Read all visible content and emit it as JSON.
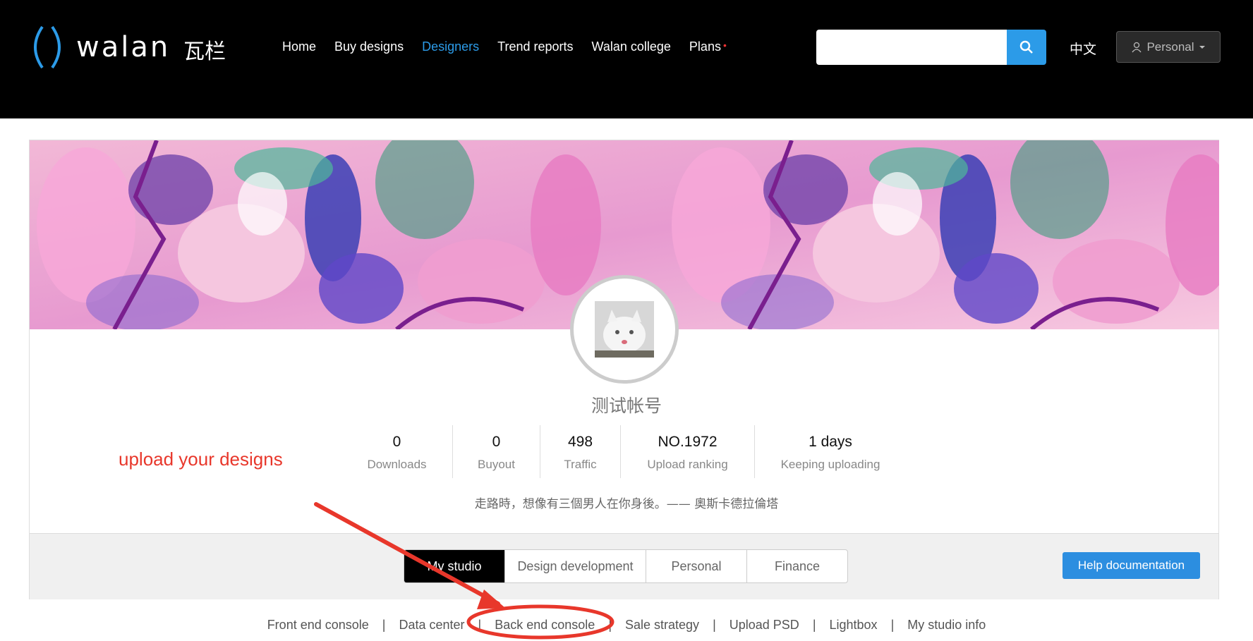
{
  "header": {
    "logo_word": "walan",
    "logo_cn": "瓦栏",
    "nav": [
      {
        "label": "Home",
        "active": false
      },
      {
        "label": "Buy designs",
        "active": false
      },
      {
        "label": "Designers",
        "active": true
      },
      {
        "label": "Trend reports",
        "active": false
      },
      {
        "label": "Walan college",
        "active": false
      },
      {
        "label": "Plans",
        "active": false,
        "badge": "•"
      }
    ],
    "search": {
      "placeholder": "",
      "value": ""
    },
    "language": "中文",
    "account_label": "Personal"
  },
  "profile": {
    "username": "测试帐号",
    "stats": [
      {
        "value": "0",
        "label": "Downloads"
      },
      {
        "value": "0",
        "label": "Buyout"
      },
      {
        "value": "498",
        "label": "Traffic"
      },
      {
        "value": "NO.1972",
        "label": "Upload ranking"
      },
      {
        "value": "1 days",
        "label": "Keeping uploading"
      }
    ],
    "motto": "走路時，想像有三個男人在你身後。—— 奧斯卡德拉倫塔"
  },
  "annotation": {
    "text": "upload your designs",
    "color": "#e8372b"
  },
  "tabs": [
    {
      "label": "My studio",
      "active": true
    },
    {
      "label": "Design development",
      "active": false
    },
    {
      "label": "Personal",
      "active": false
    },
    {
      "label": "Finance",
      "active": false
    }
  ],
  "help_label": "Help documentation",
  "subnav": [
    "Front end console",
    "Data center",
    "Back end console",
    "Sale strategy",
    "Upload PSD",
    "Lightbox",
    "My studio info"
  ],
  "colors": {
    "accent": "#2c9be8",
    "annotation": "#e8372b"
  }
}
